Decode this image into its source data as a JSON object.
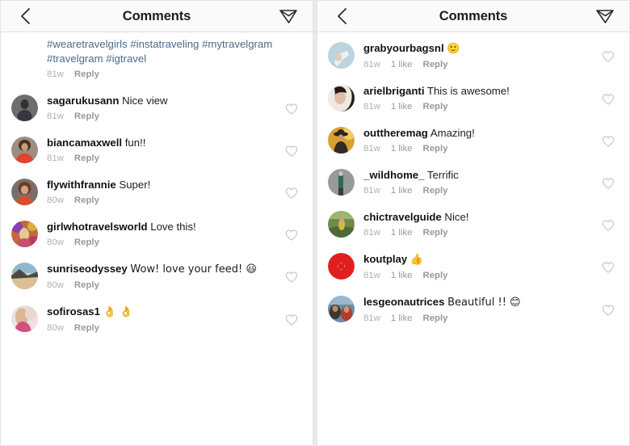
{
  "panels": [
    {
      "header": {
        "title": "Comments",
        "back_icon": "chevron-left-icon",
        "send_icon": "paper-plane-icon"
      },
      "comments": [
        {
          "type": "hashtags",
          "username": "",
          "text": "#wearetravelgirls #instatraveling #mytravelgram #travelgram #igtravel",
          "age": "81w",
          "likes": "",
          "reply": "Reply",
          "avatar": "none",
          "like_icon": "heart-outline-icon"
        },
        {
          "type": "comment",
          "username": "sagarukusann",
          "text": "Nice view",
          "age": "81w",
          "likes": "",
          "reply": "Reply",
          "avatar": "avatar-dark-portrait",
          "like_icon": "heart-outline-icon"
        },
        {
          "type": "comment",
          "username": "biancamaxwell",
          "text": "fun!!",
          "age": "81w",
          "likes": "",
          "reply": "Reply",
          "avatar": "avatar-red-dress-woman",
          "like_icon": "heart-outline-icon"
        },
        {
          "type": "comment",
          "username": "flywithfrannie",
          "text": "Super!",
          "age": "80w",
          "likes": "",
          "reply": "Reply",
          "avatar": "avatar-smiling-woman",
          "like_icon": "heart-outline-icon"
        },
        {
          "type": "comment",
          "username": "girlwhotravelsworld",
          "text": "Love this!",
          "age": "80w",
          "likes": "",
          "reply": "Reply",
          "avatar": "avatar-colorful-party",
          "like_icon": "heart-outline-icon"
        },
        {
          "type": "comment",
          "username": "sunriseodyssey",
          "text": "Wow! love your feed! 😃",
          "age": "80w",
          "likes": "",
          "reply": "Reply",
          "avatar": "avatar-beach-landscape",
          "like_icon": "heart-outline-icon"
        },
        {
          "type": "comment",
          "username": "sofirosas1",
          "text": "👌 👌",
          "age": "80w",
          "likes": "",
          "reply": "Reply",
          "avatar": "avatar-pink-portrait",
          "like_icon": "heart-outline-icon"
        }
      ]
    },
    {
      "header": {
        "title": "Comments",
        "back_icon": "chevron-left-icon",
        "send_icon": "paper-plane-icon"
      },
      "comments": [
        {
          "type": "comment",
          "username": "grabyourbagsnl",
          "text": "🙂",
          "age": "81w",
          "likes": "1 like",
          "reply": "Reply",
          "avatar": "avatar-blue-hands",
          "like_icon": "heart-outline-icon"
        },
        {
          "type": "comment",
          "username": "arielbriganti",
          "text": "This is awesome!",
          "age": "81w",
          "likes": "1 like",
          "reply": "Reply",
          "avatar": "avatar-dark-hair-woman",
          "like_icon": "heart-outline-icon"
        },
        {
          "type": "comment",
          "username": "outtheremag",
          "text": "Amazing!",
          "age": "81w",
          "likes": "1 like",
          "reply": "Reply",
          "avatar": "avatar-hat-man-sunset",
          "like_icon": "heart-outline-icon"
        },
        {
          "type": "comment",
          "username": "_wildhome_",
          "text": "Terrific",
          "age": "81w",
          "likes": "1 like",
          "reply": "Reply",
          "avatar": "avatar-grey-figure",
          "like_icon": "heart-outline-icon"
        },
        {
          "type": "comment",
          "username": "chictravelguide",
          "text": "Nice!",
          "age": "81w",
          "likes": "1 like",
          "reply": "Reply",
          "avatar": "avatar-green-field",
          "like_icon": "heart-outline-icon"
        },
        {
          "type": "comment",
          "username": "koutplay",
          "text": "👍",
          "age": "81w",
          "likes": "1 like",
          "reply": "Reply",
          "avatar": "avatar-red-logo",
          "like_icon": "heart-outline-icon"
        },
        {
          "type": "comment",
          "username": "lesgeonautrices",
          "text": "Beautiful !! 😊",
          "age": "81w",
          "likes": "1 like",
          "reply": "Reply",
          "avatar": "avatar-group-photo",
          "like_icon": "heart-outline-icon"
        }
      ]
    }
  ],
  "colors": {
    "header_bg": "#fafafa",
    "hashtag_link": "#4a6b8a",
    "meta_grey": "#9a9a9a",
    "text_dark": "#1c1c1c"
  }
}
